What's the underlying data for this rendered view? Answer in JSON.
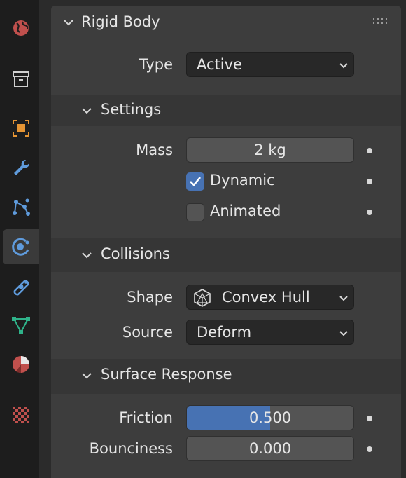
{
  "sidebar": {
    "tabs": [
      {
        "icon": "scene-world-icon",
        "active": false
      },
      {
        "icon": "collection-icon",
        "active": false
      },
      {
        "icon": "object-icon",
        "active": false
      },
      {
        "icon": "modifier-wrench-icon",
        "active": false
      },
      {
        "icon": "particles-icon",
        "active": false
      },
      {
        "icon": "physics-icon",
        "active": true
      },
      {
        "icon": "constraints-icon",
        "active": false
      },
      {
        "icon": "mesh-data-icon",
        "active": false
      },
      {
        "icon": "material-icon",
        "active": false
      },
      {
        "icon": "texture-icon",
        "active": false
      }
    ]
  },
  "panel": {
    "title": "Rigid Body",
    "type": {
      "label": "Type",
      "value": "Active"
    },
    "settings": {
      "title": "Settings",
      "mass": {
        "label": "Mass",
        "value": "2 kg"
      },
      "dynamic": {
        "label": "Dynamic",
        "checked": true
      },
      "animated": {
        "label": "Animated",
        "checked": false
      }
    },
    "collisions": {
      "title": "Collisions",
      "shape": {
        "label": "Shape",
        "value": "Convex Hull",
        "icon": "convex-hull-icon"
      },
      "source": {
        "label": "Source",
        "value": "Deform"
      }
    },
    "surface_response": {
      "title": "Surface Response",
      "friction": {
        "label": "Friction",
        "value": "0.500",
        "fraction": 0.5
      },
      "bounciness": {
        "label": "Bounciness",
        "value": "0.000",
        "fraction": 0.0
      }
    }
  },
  "colors": {
    "accent": "#4772b3",
    "background": "#2b2b2b",
    "panel": "#3d3d3d"
  }
}
